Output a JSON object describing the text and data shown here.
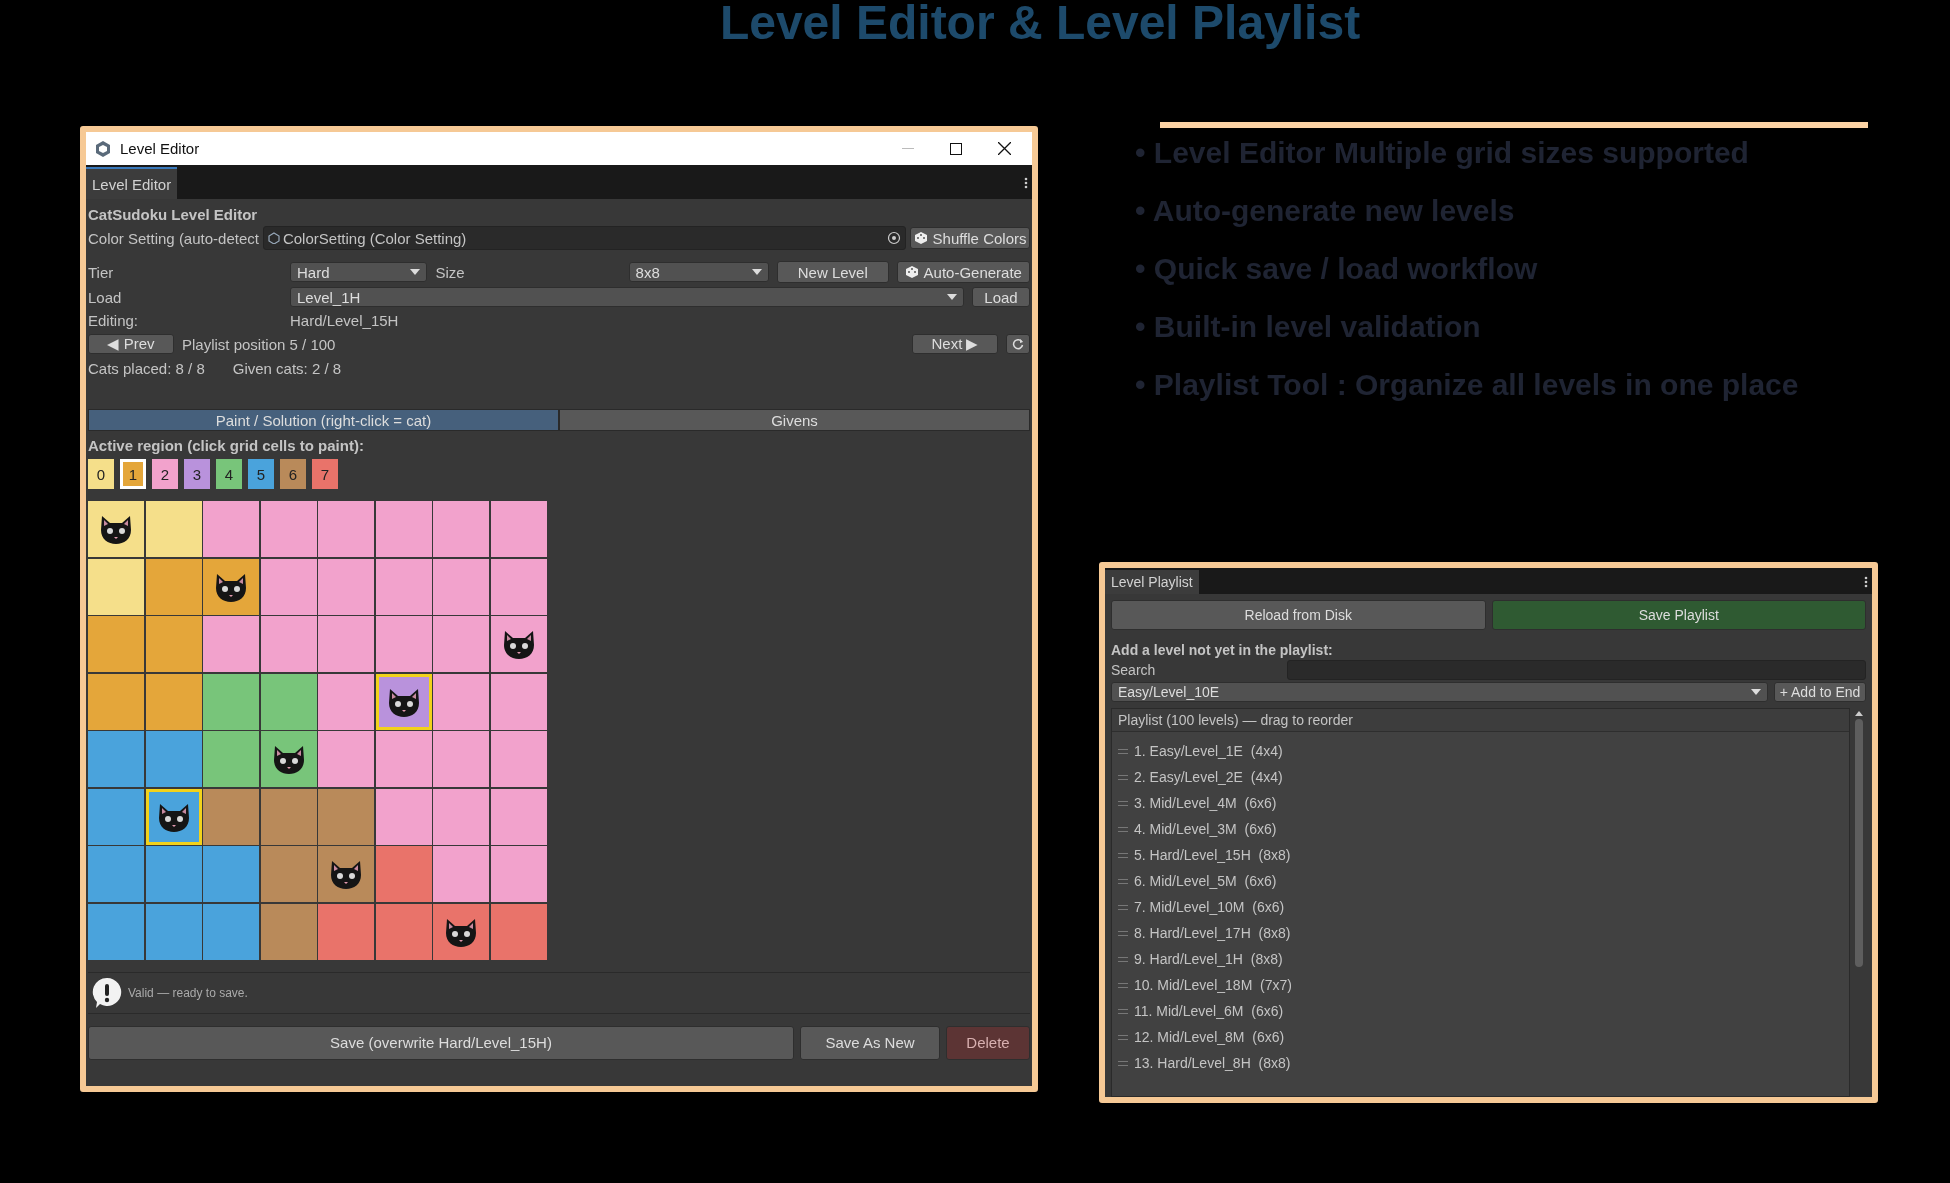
{
  "page_title": "Level Editor & Level Playlist",
  "features": [
    "• Level Editor Multiple grid sizes supported",
    "• Auto-generate new levels",
    "• Quick save / load workflow",
    "• Built-in level validation",
    "• Playlist Tool : Organize all levels in one place"
  ],
  "level_editor": {
    "window_title": "Level Editor",
    "tab": "Level Editor",
    "heading": "CatSudoku Level Editor",
    "color_setting": {
      "label": "Color Setting (auto-detect",
      "value": "ColorSetting (Color Setting)",
      "button": "Shuffle Colors"
    },
    "tier": {
      "label": "Tier",
      "value": "Hard"
    },
    "size": {
      "label": "Size",
      "value": "8x8"
    },
    "new_level_button": "New Level",
    "auto_generate_button": "Auto-Generate",
    "load": {
      "label": "Load",
      "value": "Level_1H",
      "button": "Load"
    },
    "editing": {
      "label": "Editing:",
      "value": "Hard/Level_15H"
    },
    "prev_button": "◀ Prev",
    "playlist_position": "Playlist position 5 / 100",
    "next_button": "Next ▶",
    "cats_placed": "Cats placed: 8 / 8",
    "given_cats": "Given cats: 2 / 8",
    "mode_tabs": [
      {
        "label": "Paint / Solution (right-click = cat)",
        "selected": true
      },
      {
        "label": "Givens",
        "selected": false
      }
    ],
    "region_label": "Active region (click grid cells to paint):",
    "regions": [
      {
        "label": "0",
        "color": "#f5df8a",
        "selected": false
      },
      {
        "label": "1",
        "color": "#e4a63a",
        "selected": true
      },
      {
        "label": "2",
        "color": "#f2a2cc",
        "selected": false
      },
      {
        "label": "3",
        "color": "#b992dc",
        "selected": false
      },
      {
        "label": "4",
        "color": "#78c57a",
        "selected": false
      },
      {
        "label": "5",
        "color": "#4aa3dc",
        "selected": false
      },
      {
        "label": "6",
        "color": "#b98a5a",
        "selected": false
      },
      {
        "label": "7",
        "color": "#e9736a",
        "selected": false
      }
    ],
    "grid": [
      [
        {
          "color": "#f5df8a",
          "cat": true,
          "given": false
        },
        {
          "color": "#f5df8a",
          "cat": false,
          "given": false
        },
        {
          "color": "#f2a2cc",
          "cat": false,
          "given": false
        },
        {
          "color": "#f2a2cc",
          "cat": false,
          "given": false
        },
        {
          "color": "#f2a2cc",
          "cat": false,
          "given": false
        },
        {
          "color": "#f2a2cc",
          "cat": false,
          "given": false
        },
        {
          "color": "#f2a2cc",
          "cat": false,
          "given": false
        },
        {
          "color": "#f2a2cc",
          "cat": false,
          "given": false
        }
      ],
      [
        {
          "color": "#f5df8a",
          "cat": false,
          "given": false
        },
        {
          "color": "#e4a63a",
          "cat": false,
          "given": false
        },
        {
          "color": "#e4a63a",
          "cat": true,
          "given": false
        },
        {
          "color": "#f2a2cc",
          "cat": false,
          "given": false
        },
        {
          "color": "#f2a2cc",
          "cat": false,
          "given": false
        },
        {
          "color": "#f2a2cc",
          "cat": false,
          "given": false
        },
        {
          "color": "#f2a2cc",
          "cat": false,
          "given": false
        },
        {
          "color": "#f2a2cc",
          "cat": false,
          "given": false
        }
      ],
      [
        {
          "color": "#e4a63a",
          "cat": false,
          "given": false
        },
        {
          "color": "#e4a63a",
          "cat": false,
          "given": false
        },
        {
          "color": "#f2a2cc",
          "cat": false,
          "given": false
        },
        {
          "color": "#f2a2cc",
          "cat": false,
          "given": false
        },
        {
          "color": "#f2a2cc",
          "cat": false,
          "given": false
        },
        {
          "color": "#f2a2cc",
          "cat": false,
          "given": false
        },
        {
          "color": "#f2a2cc",
          "cat": false,
          "given": false
        },
        {
          "color": "#f2a2cc",
          "cat": true,
          "given": false
        }
      ],
      [
        {
          "color": "#e4a63a",
          "cat": false,
          "given": false
        },
        {
          "color": "#e4a63a",
          "cat": false,
          "given": false
        },
        {
          "color": "#78c57a",
          "cat": false,
          "given": false
        },
        {
          "color": "#78c57a",
          "cat": false,
          "given": false
        },
        {
          "color": "#f2a2cc",
          "cat": false,
          "given": false
        },
        {
          "color": "#b992dc",
          "cat": true,
          "given": true
        },
        {
          "color": "#f2a2cc",
          "cat": false,
          "given": false
        },
        {
          "color": "#f2a2cc",
          "cat": false,
          "given": false
        }
      ],
      [
        {
          "color": "#4aa3dc",
          "cat": false,
          "given": false
        },
        {
          "color": "#4aa3dc",
          "cat": false,
          "given": false
        },
        {
          "color": "#78c57a",
          "cat": false,
          "given": false
        },
        {
          "color": "#78c57a",
          "cat": true,
          "given": false
        },
        {
          "color": "#f2a2cc",
          "cat": false,
          "given": false
        },
        {
          "color": "#f2a2cc",
          "cat": false,
          "given": false
        },
        {
          "color": "#f2a2cc",
          "cat": false,
          "given": false
        },
        {
          "color": "#f2a2cc",
          "cat": false,
          "given": false
        }
      ],
      [
        {
          "color": "#4aa3dc",
          "cat": false,
          "given": false
        },
        {
          "color": "#4aa3dc",
          "cat": true,
          "given": true
        },
        {
          "color": "#b98a5a",
          "cat": false,
          "given": false
        },
        {
          "color": "#b98a5a",
          "cat": false,
          "given": false
        },
        {
          "color": "#b98a5a",
          "cat": false,
          "given": false
        },
        {
          "color": "#f2a2cc",
          "cat": false,
          "given": false
        },
        {
          "color": "#f2a2cc",
          "cat": false,
          "given": false
        },
        {
          "color": "#f2a2cc",
          "cat": false,
          "given": false
        }
      ],
      [
        {
          "color": "#4aa3dc",
          "cat": false,
          "given": false
        },
        {
          "color": "#4aa3dc",
          "cat": false,
          "given": false
        },
        {
          "color": "#4aa3dc",
          "cat": false,
          "given": false
        },
        {
          "color": "#b98a5a",
          "cat": false,
          "given": false
        },
        {
          "color": "#b98a5a",
          "cat": true,
          "given": false
        },
        {
          "color": "#e9736a",
          "cat": false,
          "given": false
        },
        {
          "color": "#f2a2cc",
          "cat": false,
          "given": false
        },
        {
          "color": "#f2a2cc",
          "cat": false,
          "given": false
        }
      ],
      [
        {
          "color": "#4aa3dc",
          "cat": false,
          "given": false
        },
        {
          "color": "#4aa3dc",
          "cat": false,
          "given": false
        },
        {
          "color": "#4aa3dc",
          "cat": false,
          "given": false
        },
        {
          "color": "#b98a5a",
          "cat": false,
          "given": false
        },
        {
          "color": "#e9736a",
          "cat": false,
          "given": false
        },
        {
          "color": "#e9736a",
          "cat": false,
          "given": false
        },
        {
          "color": "#e9736a",
          "cat": true,
          "given": false
        },
        {
          "color": "#e9736a",
          "cat": false,
          "given": false
        }
      ]
    ],
    "validation_message": "Valid — ready to save.",
    "save_button": "Save (overwrite Hard/Level_15H)",
    "save_as_new_button": "Save As New",
    "delete_button": "Delete"
  },
  "level_playlist": {
    "tab": "Level Playlist",
    "reload_button": "Reload from Disk",
    "save_button": "Save Playlist",
    "add_heading": "Add a level not yet in the playlist:",
    "search_label": "Search",
    "level_select": "Easy/Level_10E",
    "add_button": "+ Add to End",
    "list_header": "Playlist (100 levels) — drag to reorder",
    "items": [
      "1. Easy/Level_1E  (4x4)",
      "2. Easy/Level_2E  (4x4)",
      "3. Mid/Level_4M  (6x6)",
      "4. Mid/Level_3M  (6x6)",
      "5. Hard/Level_15H  (8x8)",
      "6. Mid/Level_5M  (6x6)",
      "7. Mid/Level_10M  (6x6)",
      "8. Hard/Level_17H  (8x8)",
      "9. Hard/Level_1H  (8x8)",
      "10. Mid/Level_18M  (7x7)",
      "11. Mid/Level_6M  (6x6)",
      "12. Mid/Level_8M  (6x6)",
      "13. Hard/Level_8H  (8x8)"
    ]
  }
}
